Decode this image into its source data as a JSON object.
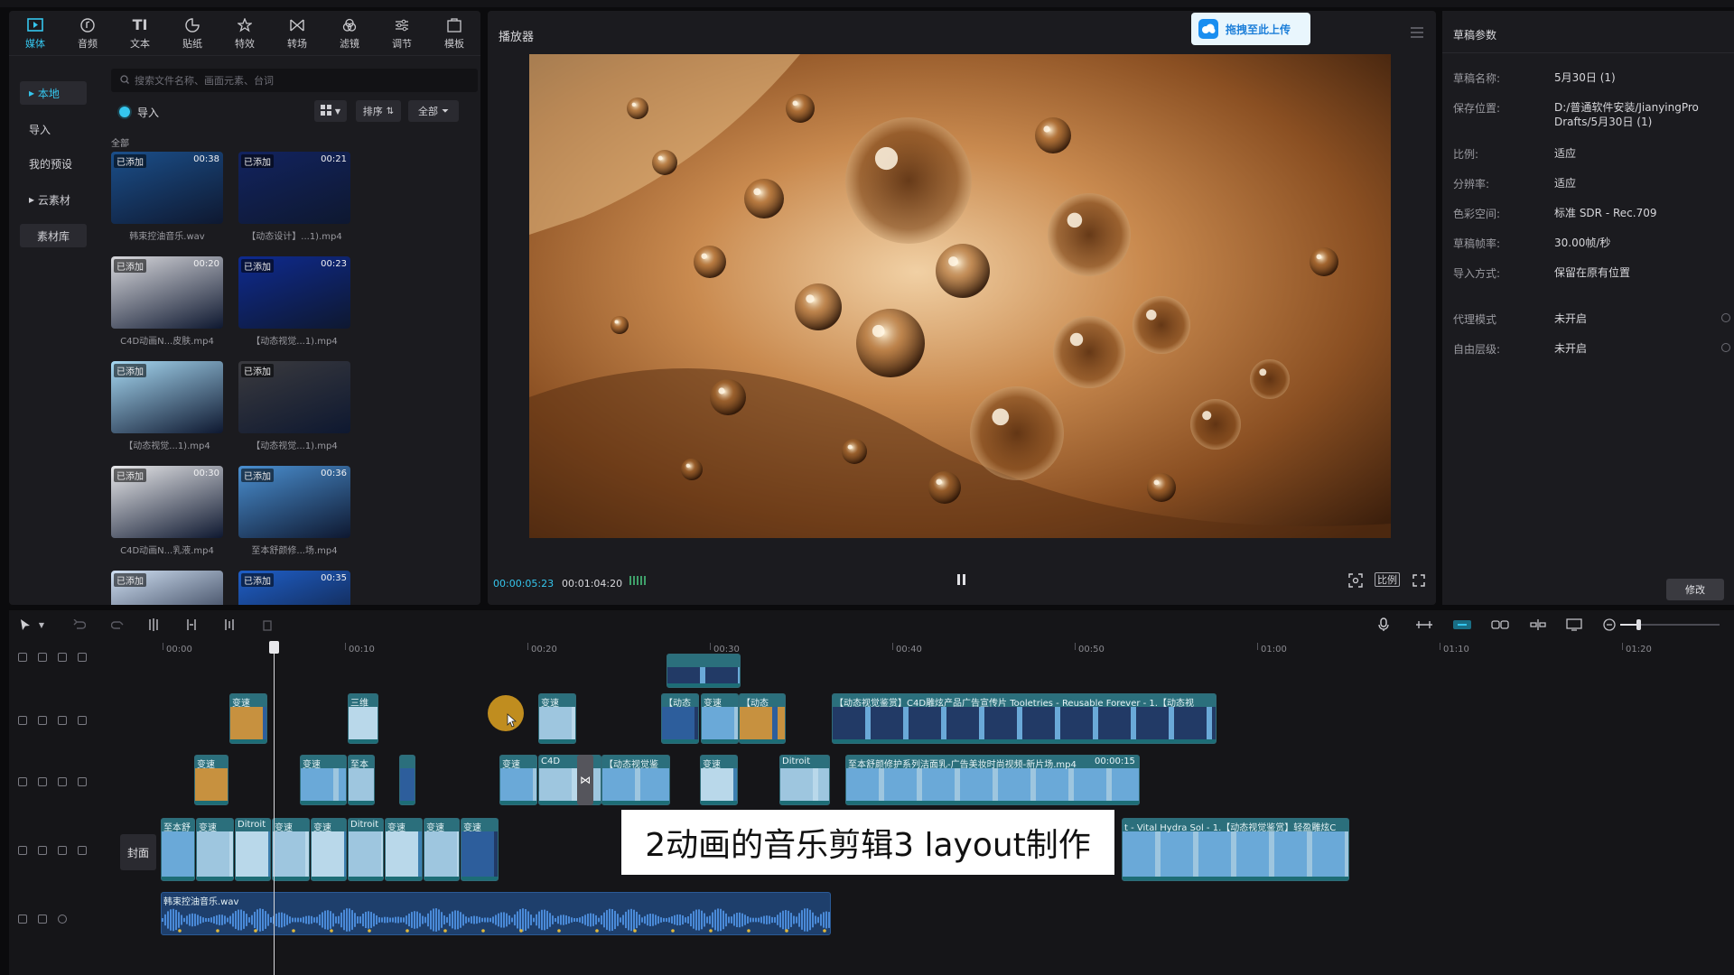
{
  "tabs": [
    {
      "label": "媒体",
      "icon": "media-icon",
      "active": true
    },
    {
      "label": "音频",
      "icon": "audio-icon"
    },
    {
      "label": "文本",
      "icon": "text-icon"
    },
    {
      "label": "贴纸",
      "icon": "sticker-icon"
    },
    {
      "label": "特效",
      "icon": "effects-icon"
    },
    {
      "label": "转场",
      "icon": "transition-icon"
    },
    {
      "label": "滤镜",
      "icon": "filter-icon"
    },
    {
      "label": "调节",
      "icon": "adjust-icon"
    },
    {
      "label": "模板",
      "icon": "template-icon"
    }
  ],
  "sidebar": {
    "items": [
      {
        "label": "本地",
        "active": true
      },
      {
        "label": "导入"
      },
      {
        "label": "我的预设"
      },
      {
        "label": "云素材"
      },
      {
        "label": "素材库"
      }
    ]
  },
  "search": {
    "placeholder": "搜索文件名称、画面元素、台词"
  },
  "media": {
    "import_label": "导入",
    "sort_label": "排序",
    "filter_label": "全部",
    "section_label": "全部",
    "added_badge": "已添加",
    "items": [
      {
        "duration": "00:38",
        "caption": "韩束控油音乐.wav",
        "color": "#1b4f8a"
      },
      {
        "duration": "00:21",
        "caption": "【动态设计】...1).mp4",
        "color": "#12235f"
      },
      {
        "duration": "00:20",
        "caption": "C4D动画N...皮肤.mp4",
        "color": "#d8d8dc"
      },
      {
        "duration": "00:23",
        "caption": "【动态视觉...1).mp4",
        "color": "#0e2a8f"
      },
      {
        "duration": "",
        "caption": "【动态视觉...1).mp4",
        "color": "#a6d8f2"
      },
      {
        "duration": "",
        "caption": "【动态视觉...1).mp4",
        "color": "#3a3a3e"
      },
      {
        "duration": "00:30",
        "caption": "C4D动画N...乳液.mp4",
        "color": "#e8e8ea"
      },
      {
        "duration": "00:36",
        "caption": "至本舒颜修...场.mp4",
        "color": "#4a8fd0"
      },
      {
        "duration": "",
        "caption": "",
        "color": "#cfdff2"
      },
      {
        "duration": "00:35",
        "caption": "",
        "color": "#1f5fc8"
      }
    ]
  },
  "player": {
    "title": "播放器",
    "upload_label": "拖拽至此上传",
    "current_time": "00:00:05:23",
    "total_time": "00:01:04:20",
    "ratio_label": "比例"
  },
  "props": {
    "title": "草稿参数",
    "rows": [
      {
        "key": "草稿名称:",
        "value": "5月30日 (1)"
      },
      {
        "key": "保存位置:",
        "value": "D:/普通软件安装/JianyingPro Drafts/5月30日 (1)"
      },
      {
        "key": "比例:",
        "value": "适应"
      },
      {
        "key": "分辨率:",
        "value": "适应"
      },
      {
        "key": "色彩空间:",
        "value": "标准 SDR - Rec.709"
      },
      {
        "key": "草稿帧率:",
        "value": "30.00帧/秒"
      },
      {
        "key": "导入方式:",
        "value": "保留在原有位置"
      },
      {
        "key": "代理模式",
        "value": "未开启"
      },
      {
        "key": "自由层级:",
        "value": "未开启"
      }
    ],
    "edit_label": "修改"
  },
  "timeline": {
    "ruler": [
      "00:00",
      "00:10",
      "00:20",
      "00:30",
      "00:40",
      "00:50",
      "01:00",
      "01:10",
      "01:20"
    ],
    "cover_label": "封面",
    "clips": {
      "c1": "变速",
      "c2": "三维",
      "c3": "变速",
      "c4": "【动态",
      "c5": "变速",
      "c6": "【动态",
      "c7": "【动态视觉鉴赏】C4D雕炫产品广告宣传片 Tooletries - Reusable Forever - 1.【动态视",
      "c8": "变速",
      "c9": "变速",
      "c10": "至本",
      "c11": "变速",
      "c12": "C4D",
      "c13": "【动态视觉鉴",
      "c14": "变速",
      "c15": "Ditroit",
      "c16": "至本舒颜修护系列洁面乳-广告美妆时尚视频-新片场.mp4",
      "c16_dur": "00:00:15",
      "c17": "至本舒",
      "c18": "变速",
      "c19": "Ditroit",
      "c20": "变速",
      "c21": "变速",
      "c22": "Ditroit",
      "c23": "变速",
      "c24": "变速",
      "c25": "变速",
      "c26": "t - Vital Hydra Sol - 1.【动态视觉鉴赏】轻盈雕炫C",
      "audio": "韩束控油音乐.wav"
    }
  },
  "subtitle": "2动画的音乐剪辑3 layout制作",
  "colors": {
    "accent": "#35c6ee",
    "panel": "#1b1b1f",
    "clip": "#2b6f7c"
  }
}
